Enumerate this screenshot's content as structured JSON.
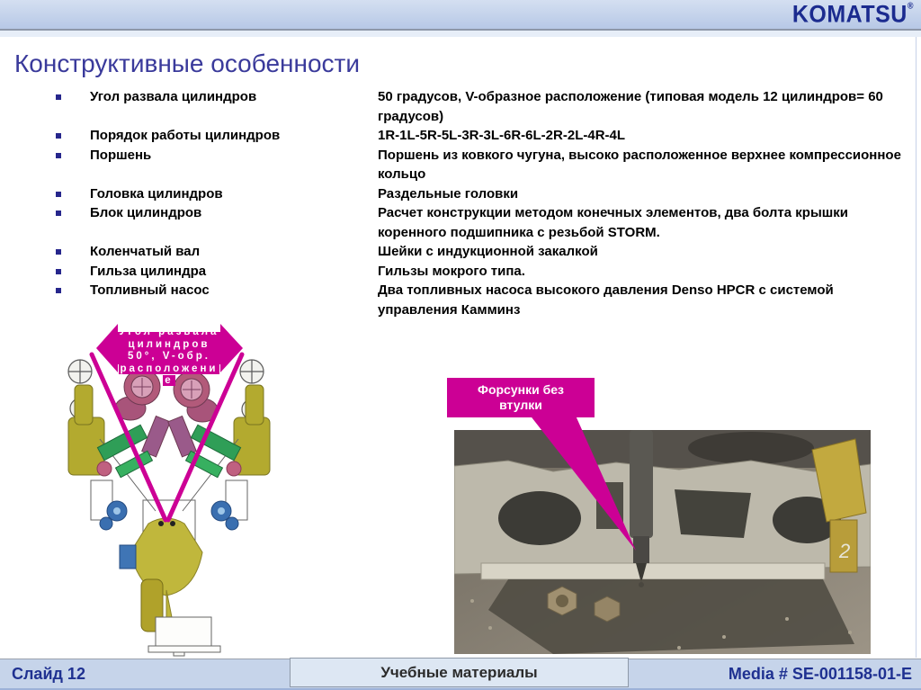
{
  "header": {
    "logo": "KOMATSU",
    "registered": "®"
  },
  "title": "Конструктивные особенности",
  "features": [
    {
      "term": "Угол развала цилиндров",
      "desc": "50 градусов, V-образное расположение (типовая модель 12 цилиндров= 60 градусов)"
    },
    {
      "term": "Порядок работы цилиндров",
      "desc": "1R-1L-5R-5L-3R-3L-6R-6L-2R-2L-4R-4L"
    },
    {
      "term": "Поршень",
      "desc": "Поршень из ковкого чугуна, высоко расположенное верхнее компрессионное кольцо"
    },
    {
      "term": "Головка цилиндров",
      "desc": "Раздельные головки"
    },
    {
      "term": "Блок цилиндров",
      "desc": "Расчет конструкции методом конечных элементов, два болта крышки коренного подшипника с резьбой STORM."
    },
    {
      "term": "Коленчатый вал",
      "desc": "Шейки с индукционной закалкой"
    },
    {
      "term": "Гильза цилиндра",
      "desc": "Гильзы мокрого типа."
    },
    {
      "term": "Топливный насос",
      "desc": "Два топливных насоса высокого давления Denso HPCR с системой управления Камминз"
    }
  ],
  "diagram_label": {
    "line1": "Угол развала",
    "line2": "цилиндров",
    "line3": "50°, V-обр.",
    "line4": "расположени",
    "line5": "е"
  },
  "photo_label": {
    "line1": "Форсунки без",
    "line2": "втулки"
  },
  "footer": {
    "slide": "Слайд 12",
    "center": "Учебные материалы",
    "media": "Media # SE-001158-01-E"
  },
  "colors": {
    "accent_magenta": "#cc0095",
    "title_blue": "#3a3a9b",
    "footer_navy": "#1f3191",
    "logo_navy": "#1b2b8f"
  }
}
